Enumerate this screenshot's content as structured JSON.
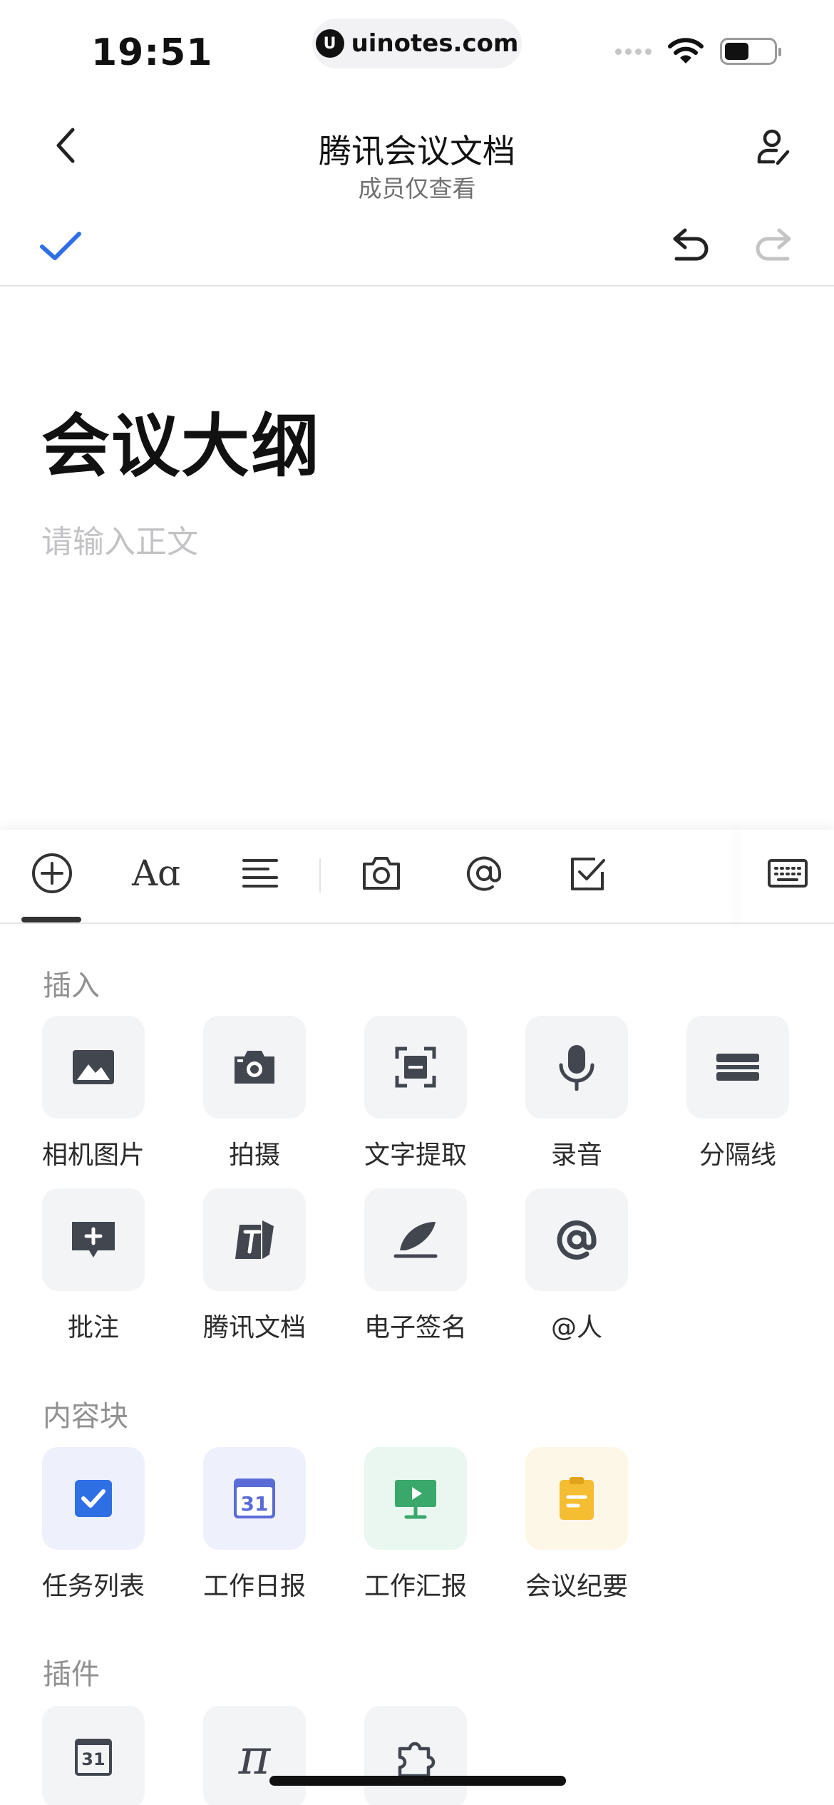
{
  "status_bar": {
    "time": "19:51",
    "url": "uinotes.com",
    "url_logo": "U"
  },
  "nav": {
    "title": "腾讯会议文档",
    "subtitle": "成员仅查看"
  },
  "editor": {
    "doc_title": "会议大纲",
    "body_placeholder": "请输入正文"
  },
  "toolbar": {
    "items": [
      "plus-circle-icon",
      "text-format-icon",
      "align-icon",
      "camera-icon",
      "at-icon",
      "checkbox-icon",
      "keyboard-icon"
    ],
    "glyphs": {
      "text_format": "Aɑ"
    }
  },
  "sections": {
    "insert": {
      "label": "插入",
      "items": [
        {
          "label": "相机图片",
          "icon": "image-icon"
        },
        {
          "label": "拍摄",
          "icon": "camera-icon"
        },
        {
          "label": "文字提取",
          "icon": "text-scan-icon"
        },
        {
          "label": "录音",
          "icon": "microphone-icon"
        },
        {
          "label": "分隔线",
          "icon": "divider-icon"
        },
        {
          "label": "批注",
          "icon": "comment-add-icon"
        },
        {
          "label": "腾讯文档",
          "icon": "tencent-docs-icon"
        },
        {
          "label": "电子签名",
          "icon": "signature-icon"
        },
        {
          "label": "@人",
          "icon": "mention-icon"
        }
      ]
    },
    "content_blocks": {
      "label": "内容块",
      "items": [
        {
          "label": "任务列表",
          "icon": "task-list-icon"
        },
        {
          "label": "工作日报",
          "icon": "calendar-icon",
          "glyph": "31"
        },
        {
          "label": "工作汇报",
          "icon": "presentation-icon"
        },
        {
          "label": "会议纪要",
          "icon": "clipboard-icon"
        }
      ]
    },
    "plugins": {
      "label": "插件",
      "items": [
        {
          "icon": "calendar-icon",
          "glyph": "31"
        },
        {
          "icon": "pi-icon",
          "glyph": "π"
        },
        {
          "icon": "puzzle-icon"
        }
      ]
    }
  },
  "colors": {
    "accent_blue": "#2f6fe4",
    "icon_gray": "#42464f",
    "task_bg": "#eef1fc",
    "report_bg": "#eaf6f0",
    "report_green": "#3aa86b",
    "minutes_bg": "#fdf7e7",
    "minutes_yellow": "#f5bd32",
    "daily_purple": "#5b6bd6"
  }
}
